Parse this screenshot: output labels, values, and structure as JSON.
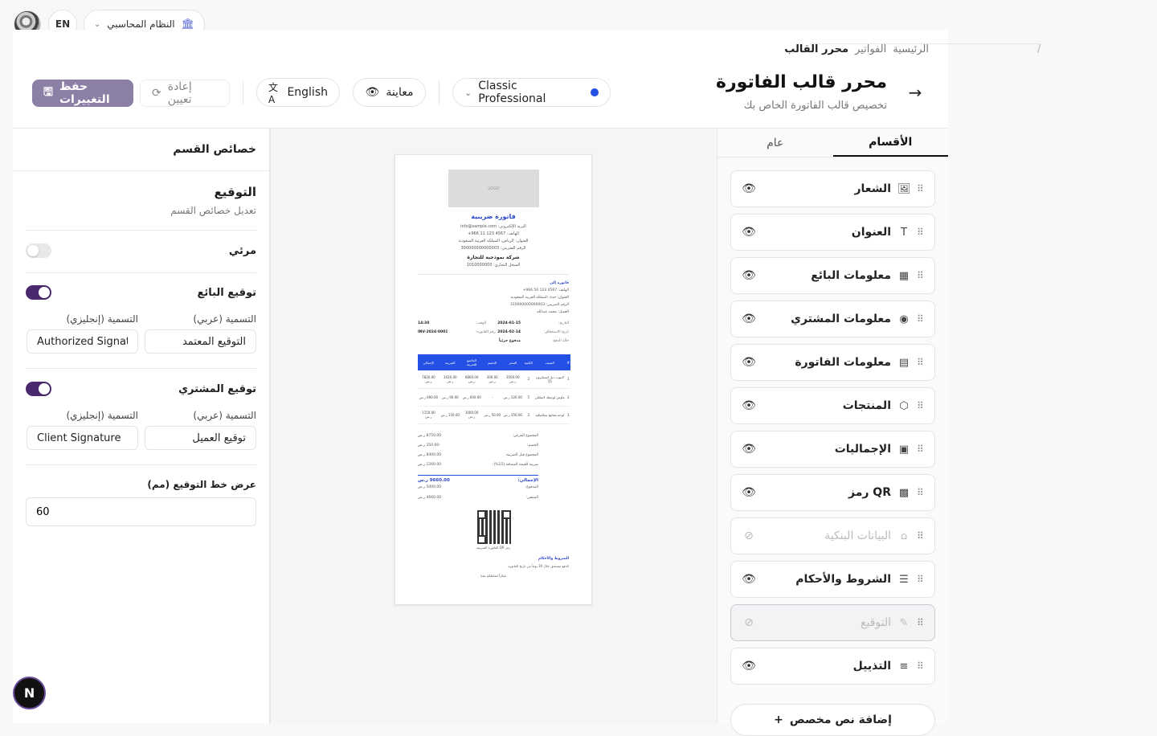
{
  "topbar": {
    "language_toggle": "EN",
    "system_selector": "النظام المحاسبي"
  },
  "breadcrumb": {
    "home": "الرئيسية",
    "invoices": "الفواتير",
    "current": "محرر القالب",
    "separator": "/"
  },
  "header": {
    "title": "محرر قالب الفاتورة",
    "subtitle": "تخصيص قالب الفاتورة الخاص بك"
  },
  "toolbar": {
    "template_name": "Classic Professional",
    "template_color": "#2450e6",
    "preview_label": "معاينة",
    "language_label": "English",
    "reset_label": "إعادة تعيين",
    "save_label": "حفظ التغييرات"
  },
  "tabs": [
    {
      "label": "عام",
      "active": false
    },
    {
      "label": "الأقسام",
      "active": true
    }
  ],
  "sections": [
    {
      "label": "الشعار",
      "icon": "image-icon",
      "glyph": "🖼",
      "visible": true
    },
    {
      "label": "العنوان",
      "icon": "text-icon",
      "glyph": "T",
      "visible": true
    },
    {
      "label": "معلومات البائع",
      "icon": "building-icon",
      "glyph": "▦",
      "visible": true
    },
    {
      "label": "معلومات المشتري",
      "icon": "user-circle-icon",
      "glyph": "◉",
      "visible": true
    },
    {
      "label": "معلومات الفاتورة",
      "icon": "document-icon",
      "glyph": "▤",
      "visible": true
    },
    {
      "label": "المنتجات",
      "icon": "package-icon",
      "glyph": "⬡",
      "visible": true
    },
    {
      "label": "الإجماليات",
      "icon": "calculator-icon",
      "glyph": "▣",
      "visible": true
    },
    {
      "label": "رمز QR",
      "icon": "qr-icon",
      "glyph": "▩",
      "visible": true
    },
    {
      "label": "البيانات البنكية",
      "icon": "bank-icon",
      "glyph": "⌂",
      "visible": false
    },
    {
      "label": "الشروط والأحكام",
      "icon": "scroll-icon",
      "glyph": "☰",
      "visible": true
    },
    {
      "label": "التوقيع",
      "icon": "signature-icon",
      "glyph": "✎",
      "visible": false,
      "selected": true
    },
    {
      "label": "التذييل",
      "icon": "footer-icon",
      "glyph": "≡",
      "visible": true
    }
  ],
  "add_custom_label": "إضافة نص مخصص",
  "properties": {
    "header": "خصائص القسم",
    "section_title": "التوقيع",
    "section_subtitle": "تعديل خصائص القسم",
    "visible_label": "مرئي",
    "visible": false,
    "seller_signature_label": "توقيع البائع",
    "seller_signature": true,
    "seller_label_ar_title": "التسمية (عربي)",
    "seller_label_en_title": "التسمية (إنجليزي)",
    "seller_label_ar": "التوقيع المعتمد",
    "seller_label_en": "Authorized Signature",
    "buyer_signature_label": "توقيع المشتري",
    "buyer_signature": true,
    "buyer_label_ar_title": "التسمية (عربي)",
    "buyer_label_en_title": "التسمية (إنجليزي)",
    "buyer_label_ar": "توقيع العميل",
    "buyer_label_en": "Client Signature",
    "line_width_label": "عرض خط التوقيع (مم)",
    "line_width": "60"
  },
  "preview": {
    "logo": "LOGO",
    "title": "فاتورة ضريبية",
    "seller_lines": [
      "البريد الإلكتروني: info@sample.com",
      "الهاتف: 4567 123 11 966+",
      "العنوان: الرياض، المملكة العربية السعودية",
      "الرقم الضريبي: 300000000000003",
      "شركة نموذجية للتجارة",
      "السجل التجاري: 1010000000"
    ],
    "bill_to": "فاتورة إلى",
    "buyer_lines": [
      "الهاتف: 4567 123 50 966+",
      "العنوان: جدة، المملكة العربية السعودية",
      "الرقم الضريبي: 310000000000003",
      "العميل: محمد عبدالله"
    ],
    "meta": [
      {
        "label": "التاريخ:",
        "value": "2024-01-15",
        "label2": "الوقت:",
        "value2": "14:30"
      },
      {
        "label": "تاريخ الاستحقاق:",
        "value": "2024-02-14",
        "label2": "رقم الفاتورة:",
        "value2": "INV-2024-0001"
      },
      {
        "label": "حالة الدفع:",
        "value": "مدفوع جزئياً",
        "label2": "",
        "value2": ""
      }
    ],
    "table_headers": [
      "#",
      "الصنف",
      "الكمية",
      "السعر",
      "الخصم",
      "الخاضع للضريبة",
      "الضريبة",
      "الإجمالي"
    ],
    "table_rows": [
      [
        "1",
        "لابتوب ديل انسبايرون 15",
        "2",
        "3500.00 ر.س",
        "300.00 ر.س",
        "6800.00 ر.س",
        "1020.00 ر.س",
        "7820.00 ر.س"
      ],
      [
        "2",
        "ماوس لوجيتك لاسلكي",
        "5",
        "120.00 ر.س",
        "-",
        "600.00 ر.س",
        "90.00 ر.س",
        "690.00 ر.س"
      ],
      [
        "3",
        "لوحة مفاتيح ميكانيكية",
        "3",
        "350.00 ر.س",
        "50.00 ر.س",
        "1000.00 ر.س",
        "150.00 ر.س",
        "1150.00 ر.س"
      ]
    ],
    "totals": [
      {
        "label": "المجموع الفرعي:",
        "value": "8750.00 ر.س"
      },
      {
        "label": "الخصم:",
        "value": "-350.00 ر.س"
      },
      {
        "label": "المجموع قبل الضريبة:",
        "value": "8400.00 ر.س"
      },
      {
        "label": "ضريبة القيمة المضافة (15%):",
        "value": "1260.00 ر.س"
      },
      {
        "label": "الإجمالي:",
        "value": "9660.00 ر.س"
      },
      {
        "label": "المدفوع:",
        "value": "5000.00 ر.س"
      },
      {
        "label": "المتبقي:",
        "value": "4660.00 ر.س"
      }
    ],
    "qr_caption": "رمز QR الفاتورة الضريبية",
    "terms_title": "الشروط والأحكام",
    "terms_text": "الدفع مستحق خلال 30 يوماً من تاريخ الفاتورة.",
    "footer": "شكراً لتعاملكم معنا"
  },
  "dev_badge": "N"
}
